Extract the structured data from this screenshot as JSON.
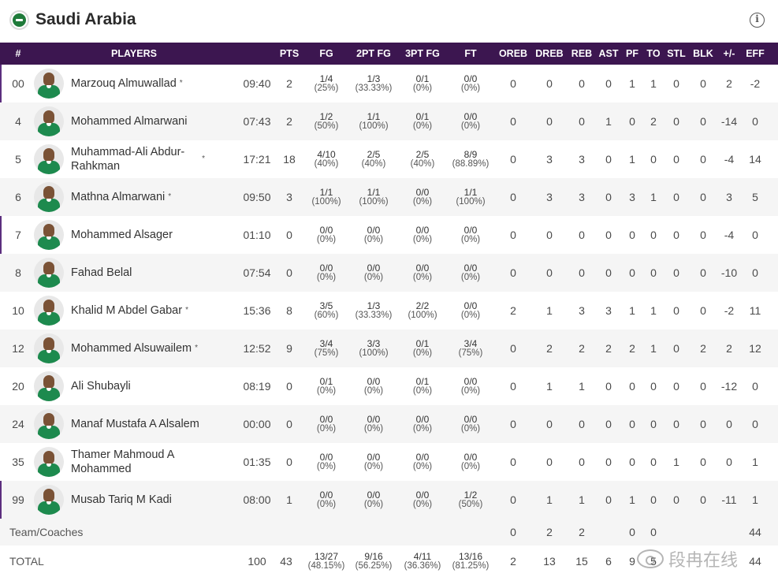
{
  "team": {
    "name": "Saudi Arabia",
    "info_icon": "info-icon",
    "flag_icon": "flag-icon"
  },
  "columns": [
    "#",
    "PLAYERS",
    "PTS",
    "FG",
    "2PT FG",
    "3PT FG",
    "FT",
    "OREB",
    "DREB",
    "REB",
    "AST",
    "PF",
    "TO",
    "STL",
    "BLK",
    "+/-",
    "EFF"
  ],
  "players": [
    {
      "num": "00",
      "name": "Marzouq Almuwallad",
      "starter": true,
      "min": "09:40",
      "pts": "2",
      "fg": [
        "1/4",
        "(25%)"
      ],
      "fg2": [
        "1/3",
        "(33.33%)"
      ],
      "fg3": [
        "0/1",
        "(0%)"
      ],
      "ft": [
        "0/0",
        "(0%)"
      ],
      "oreb": "0",
      "dreb": "0",
      "reb": "0",
      "ast": "0",
      "pf": "1",
      "to": "1",
      "stl": "0",
      "blk": "0",
      "pm": "2",
      "eff": "-2"
    },
    {
      "num": "4",
      "name": "Mohammed Almarwani",
      "starter": false,
      "min": "07:43",
      "pts": "2",
      "fg": [
        "1/2",
        "(50%)"
      ],
      "fg2": [
        "1/1",
        "(100%)"
      ],
      "fg3": [
        "0/1",
        "(0%)"
      ],
      "ft": [
        "0/0",
        "(0%)"
      ],
      "oreb": "0",
      "dreb": "0",
      "reb": "0",
      "ast": "1",
      "pf": "0",
      "to": "2",
      "stl": "0",
      "blk": "0",
      "pm": "-14",
      "eff": "0"
    },
    {
      "num": "5",
      "name": "Muhammad-Ali Abdur-Rahkman",
      "starter": true,
      "min": "17:21",
      "pts": "18",
      "fg": [
        "4/10",
        "(40%)"
      ],
      "fg2": [
        "2/5",
        "(40%)"
      ],
      "fg3": [
        "2/5",
        "(40%)"
      ],
      "ft": [
        "8/9",
        "(88.89%)"
      ],
      "oreb": "0",
      "dreb": "3",
      "reb": "3",
      "ast": "0",
      "pf": "1",
      "to": "0",
      "stl": "0",
      "blk": "0",
      "pm": "-4",
      "eff": "14"
    },
    {
      "num": "6",
      "name": "Mathna Almarwani",
      "starter": true,
      "min": "09:50",
      "pts": "3",
      "fg": [
        "1/1",
        "(100%)"
      ],
      "fg2": [
        "1/1",
        "(100%)"
      ],
      "fg3": [
        "0/0",
        "(0%)"
      ],
      "ft": [
        "1/1",
        "(100%)"
      ],
      "oreb": "0",
      "dreb": "3",
      "reb": "3",
      "ast": "0",
      "pf": "3",
      "to": "1",
      "stl": "0",
      "blk": "0",
      "pm": "3",
      "eff": "5"
    },
    {
      "num": "7",
      "name": "Mohammed Alsager",
      "starter": false,
      "min": "01:10",
      "pts": "0",
      "fg": [
        "0/0",
        "(0%)"
      ],
      "fg2": [
        "0/0",
        "(0%)"
      ],
      "fg3": [
        "0/0",
        "(0%)"
      ],
      "ft": [
        "0/0",
        "(0%)"
      ],
      "oreb": "0",
      "dreb": "0",
      "reb": "0",
      "ast": "0",
      "pf": "0",
      "to": "0",
      "stl": "0",
      "blk": "0",
      "pm": "-4",
      "eff": "0"
    },
    {
      "num": "8",
      "name": "Fahad Belal",
      "starter": false,
      "min": "07:54",
      "pts": "0",
      "fg": [
        "0/0",
        "(0%)"
      ],
      "fg2": [
        "0/0",
        "(0%)"
      ],
      "fg3": [
        "0/0",
        "(0%)"
      ],
      "ft": [
        "0/0",
        "(0%)"
      ],
      "oreb": "0",
      "dreb": "0",
      "reb": "0",
      "ast": "0",
      "pf": "0",
      "to": "0",
      "stl": "0",
      "blk": "0",
      "pm": "-10",
      "eff": "0"
    },
    {
      "num": "10",
      "name": "Khalid M Abdel Gabar",
      "starter": true,
      "min": "15:36",
      "pts": "8",
      "fg": [
        "3/5",
        "(60%)"
      ],
      "fg2": [
        "1/3",
        "(33.33%)"
      ],
      "fg3": [
        "2/2",
        "(100%)"
      ],
      "ft": [
        "0/0",
        "(0%)"
      ],
      "oreb": "2",
      "dreb": "1",
      "reb": "3",
      "ast": "3",
      "pf": "1",
      "to": "1",
      "stl": "0",
      "blk": "0",
      "pm": "-2",
      "eff": "11"
    },
    {
      "num": "12",
      "name": "Mohammed Alsuwailem",
      "starter": true,
      "min": "12:52",
      "pts": "9",
      "fg": [
        "3/4",
        "(75%)"
      ],
      "fg2": [
        "3/3",
        "(100%)"
      ],
      "fg3": [
        "0/1",
        "(0%)"
      ],
      "ft": [
        "3/4",
        "(75%)"
      ],
      "oreb": "0",
      "dreb": "2",
      "reb": "2",
      "ast": "2",
      "pf": "2",
      "to": "1",
      "stl": "0",
      "blk": "2",
      "pm": "2",
      "eff": "12"
    },
    {
      "num": "20",
      "name": "Ali Shubayli",
      "starter": false,
      "min": "08:19",
      "pts": "0",
      "fg": [
        "0/1",
        "(0%)"
      ],
      "fg2": [
        "0/0",
        "(0%)"
      ],
      "fg3": [
        "0/1",
        "(0%)"
      ],
      "ft": [
        "0/0",
        "(0%)"
      ],
      "oreb": "0",
      "dreb": "1",
      "reb": "1",
      "ast": "0",
      "pf": "0",
      "to": "0",
      "stl": "0",
      "blk": "0",
      "pm": "-12",
      "eff": "0"
    },
    {
      "num": "24",
      "name": "Manaf Mustafa A Alsalem",
      "starter": false,
      "min": "00:00",
      "pts": "0",
      "fg": [
        "0/0",
        "(0%)"
      ],
      "fg2": [
        "0/0",
        "(0%)"
      ],
      "fg3": [
        "0/0",
        "(0%)"
      ],
      "ft": [
        "0/0",
        "(0%)"
      ],
      "oreb": "0",
      "dreb": "0",
      "reb": "0",
      "ast": "0",
      "pf": "0",
      "to": "0",
      "stl": "0",
      "blk": "0",
      "pm": "0",
      "eff": "0"
    },
    {
      "num": "35",
      "name": "Thamer Mahmoud A Mohammed",
      "starter": false,
      "min": "01:35",
      "pts": "0",
      "fg": [
        "0/0",
        "(0%)"
      ],
      "fg2": [
        "0/0",
        "(0%)"
      ],
      "fg3": [
        "0/0",
        "(0%)"
      ],
      "ft": [
        "0/0",
        "(0%)"
      ],
      "oreb": "0",
      "dreb": "0",
      "reb": "0",
      "ast": "0",
      "pf": "0",
      "to": "0",
      "stl": "1",
      "blk": "0",
      "pm": "0",
      "eff": "1"
    },
    {
      "num": "99",
      "name": "Musab Tariq M Kadi",
      "starter": false,
      "min": "08:00",
      "pts": "1",
      "fg": [
        "0/0",
        "(0%)"
      ],
      "fg2": [
        "0/0",
        "(0%)"
      ],
      "fg3": [
        "0/0",
        "(0%)"
      ],
      "ft": [
        "1/2",
        "(50%)"
      ],
      "oreb": "0",
      "dreb": "1",
      "reb": "1",
      "ast": "0",
      "pf": "1",
      "to": "0",
      "stl": "0",
      "blk": "0",
      "pm": "-11",
      "eff": "1"
    }
  ],
  "team_coaches": {
    "label": "Team/Coaches",
    "oreb": "0",
    "dreb": "2",
    "reb": "2",
    "pf": "0",
    "to": "0",
    "eff": "44"
  },
  "total": {
    "label": "TOTAL",
    "min": "100",
    "pts": "43",
    "fg": [
      "13/27",
      "(48.15%)"
    ],
    "fg2": [
      "9/16",
      "(56.25%)"
    ],
    "fg3": [
      "4/11",
      "(36.36%)"
    ],
    "ft": [
      "13/16",
      "(81.25%)"
    ],
    "oreb": "2",
    "dreb": "13",
    "reb": "15",
    "ast": "6",
    "pf": "9",
    "to": "5",
    "eff": "44"
  },
  "watermark": "段冉在线",
  "colors": {
    "header_bg": "#3c1650",
    "starter_bar": "#5c2e7e",
    "jersey": "#1d8a4e"
  }
}
